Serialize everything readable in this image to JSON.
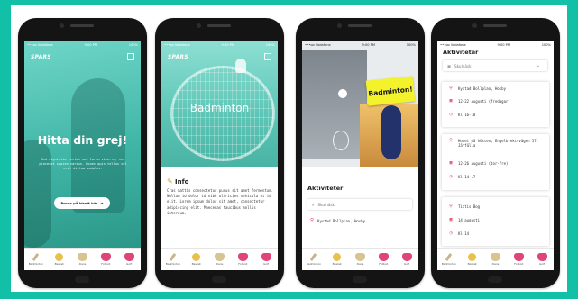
{
  "colors": {
    "frame": "#12c0a8",
    "teal": "#3fb5a6",
    "pink": "#e2385b",
    "yellow": "#f4f22b"
  },
  "statusbar": {
    "carrier": "•••oo Vodafone ",
    "time": "9:00 PM",
    "battery": "100%"
  },
  "tabs": [
    {
      "label": "Badminton",
      "icon": "racket-icon",
      "color": "#c9b48a"
    },
    {
      "label": "Basket",
      "icon": "ball-icon",
      "color": "#e9c04a"
    },
    {
      "label": "Dans",
      "icon": "shoe-icon",
      "color": "#d8c48e"
    },
    {
      "label": "Fotboll",
      "icon": "jersey-icon",
      "color": "#e0457a"
    },
    {
      "label": "Golf",
      "icon": "jersey-icon",
      "color": "#e0457a"
    }
  ],
  "screen1": {
    "logo": "SPARS",
    "title": "Hitta din grej!",
    "body": "Sed dignissim lectus sed lorem viverra, nec placerat sapien varius. Donec quis tellus vel erat dictum sodales.",
    "button": "Prova på idrott här",
    "button_arrow": "➔"
  },
  "screen2": {
    "logo": "SPARS",
    "title": "Badminton",
    "info_title": "Info",
    "info_body": "Cras mattis consectetur purus sit amet fermentum. Nullam id dolor id nibh ultricies vehicula ut id elit. Lorem ipsum dolor sit amet, consectetur adipiscing elit. Maecenas faucibus mollis interdum."
  },
  "screen3": {
    "sticker": "Badminton!",
    "section": "Aktiviteter",
    "search_placeholder": "Skulnäsk",
    "activity": "Kystad Bollplan, Hosby"
  },
  "screen4": {
    "section": "Aktiviteter",
    "select_value": "Skulnäsk",
    "cards": [
      {
        "place": "Kystad Bollplan, Hosby",
        "date": "12-22 augusti (fredagar)",
        "time": "Kl 16-18"
      },
      {
        "place": "Hovet på hösten, Engelbrektsvägen 57, Järfälla",
        "date": "12-26 augusti (tor-fre)",
        "time": "Kl 14-17"
      },
      {
        "place": "Tittis Bog",
        "date": "14 augusti",
        "time": "Kl 14"
      }
    ]
  }
}
